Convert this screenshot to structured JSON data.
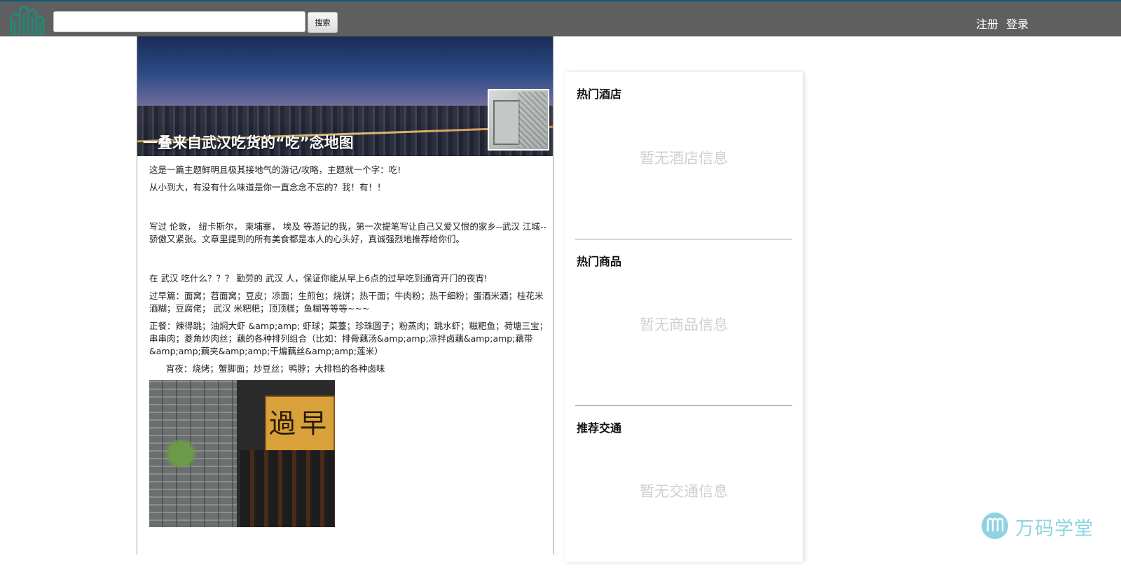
{
  "header": {
    "search": {
      "value": "",
      "placeholder": ""
    },
    "search_button_label": "搜索",
    "register_label": "注册",
    "login_label": "登录"
  },
  "article": {
    "title": "一叠来自武汉吃货的“吃”念地图",
    "paragraphs": [
      "这是一篇主题鲜明且极其接地气的游记/攻略，主题就一个字：吃!",
      "从小到大，有没有什么味道是你一直念念不忘的？我！有！！",
      "写过 伦敦， 纽卡斯尔， 柬埔寨， 埃及 等游记的我，第一次提笔写让自己又爱又恨的家乡--武汉 江城--骄傲又紧张。文章里提到的所有美食都是本人的心头好，真诚强烈地推荐给你们。",
      "在 武汉 吃什么？？？ 勤劳的 武汉 人，保证你能从早上6点的过早吃到通宵开门的夜宵!",
      " 过早篇：面窝；苕面窝；豆皮；凉面；生煎包；烧饼；热干面；牛肉粉；热干细粉；蛋酒米酒；桂花米酒糊；豆腐佬； 武汉 米粑粑；顶顶糕；鱼糊等等等~~~",
      "   正餐：辣得跳；油焖大虾 &amp;amp; 虾球；菜薹；珍珠圆子；粉蒸肉；跳水虾；糍粑鱼；荷塘三宝；串串肉；菱角炒肉丝；藕的各种排列组合（比如：排骨藕汤&amp;amp;凉拌卤藕&amp;amp;藕带&amp;amp;藕夹&amp;amp;干煸藕丝&amp;amp;莲米）",
      "      宵夜：烧烤；蟹脚面；炒豆丝；鸭脖；大排档的各种卤味"
    ],
    "photo_plaque_text": "過早"
  },
  "sidebar": {
    "hotels": {
      "title": "热门酒店",
      "empty": "暂无酒店信息"
    },
    "products": {
      "title": "热门商品",
      "empty": "暂无商品信息"
    },
    "transport": {
      "title": "推荐交通",
      "empty": "暂无交通信息"
    }
  },
  "watermark": {
    "text": "万码学堂",
    "icon": "wanma-logo-icon"
  },
  "colors": {
    "topbar_bg": "#5f5f5f",
    "topbar_accent": "#0e5a7a",
    "logo_green": "#1f8a7a",
    "placeholder_gray": "#d0d0d0",
    "watermark_blue": "#8fd3e2"
  },
  "icons": {
    "logo": "city-logo-icon"
  }
}
